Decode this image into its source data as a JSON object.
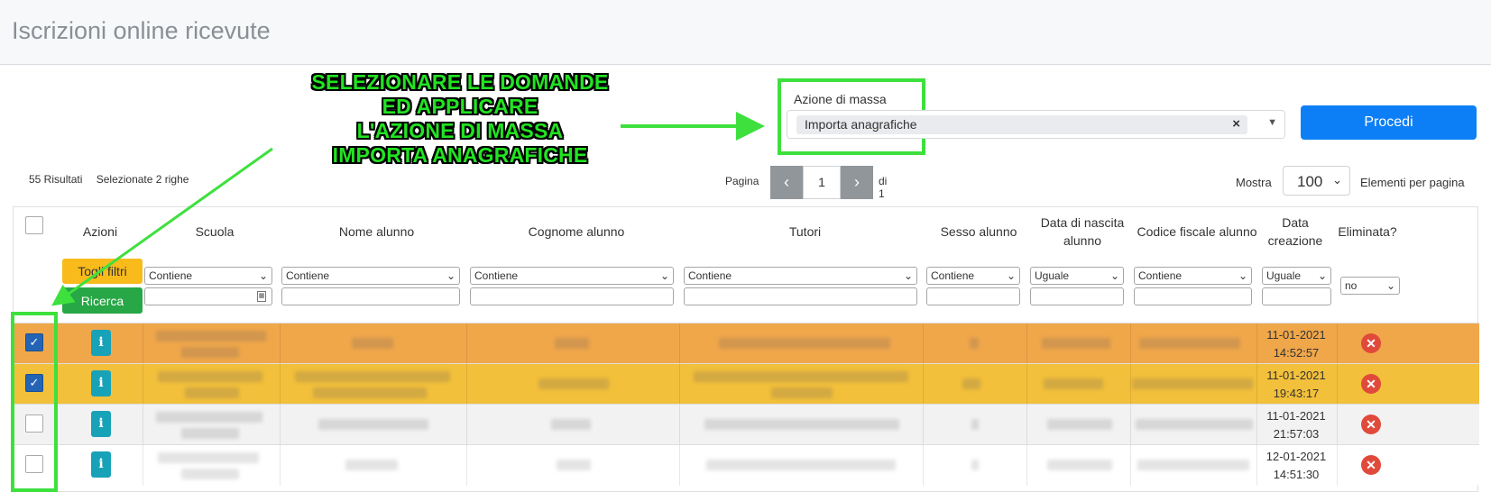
{
  "page": {
    "title": "Iscrizioni online ricevute"
  },
  "annotation": {
    "lines": [
      "SELEZIONARE LE DOMANDE",
      "ED APPLICARE",
      "L'AZIONE DI MASSA",
      "IMPORTA ANAGRAFICHE"
    ],
    "color": "#3ee03e"
  },
  "mass_action": {
    "label": "Azione di massa",
    "selected": "Importa anagrafiche",
    "clear_symbol": "×",
    "proceed_label": "Procedi"
  },
  "results": {
    "count": "55 Risultati",
    "selected": "Selezionate 2 righe"
  },
  "pagination": {
    "page_label": "Pagina",
    "current": "1",
    "of_label": "di 1"
  },
  "page_size": {
    "show_label": "Mostra",
    "value": "100",
    "per_page_label": "Elementi per pagina"
  },
  "table": {
    "headers": {
      "actions": "Azioni",
      "school": "Scuola",
      "student_name": "Nome alunno",
      "student_surname": "Cognome alunno",
      "tutors": "Tutori",
      "sex": "Sesso alunno",
      "birth_date": "Data di nascita alunno",
      "tax_code": "Codice fiscale alunno",
      "created": "Data creazione",
      "deleted": "Eliminata?"
    },
    "buttons": {
      "clear_filters": "Togli filtri",
      "search": "Ricerca"
    },
    "filters": {
      "school": "Contiene",
      "student_name": "Contiene",
      "student_surname": "Contiene",
      "tutors": "Contiene",
      "sex": "Contiene",
      "birth_date": "Uguale",
      "tax_code": "Contiene",
      "created": "Uguale",
      "deleted": "no"
    },
    "rows": [
      {
        "checked": true,
        "date": "11-01-2021",
        "time": "14:52:57",
        "highlight": "#f0a74a"
      },
      {
        "checked": true,
        "date": "11-01-2021",
        "time": "19:43:17",
        "highlight": "#f2c03a"
      },
      {
        "checked": false,
        "date": "11-01-2021",
        "time": "21:57:03",
        "highlight": "#f2f2f2"
      },
      {
        "checked": false,
        "date": "12-01-2021",
        "time": "14:51:30",
        "highlight": "#ffffff"
      }
    ]
  },
  "icons": {
    "info": "info-icon",
    "delete": "delete-icon",
    "prev": "chevron-left-icon",
    "next": "chevron-right-icon",
    "calendar": "calendar-icon",
    "check": "check-icon"
  }
}
